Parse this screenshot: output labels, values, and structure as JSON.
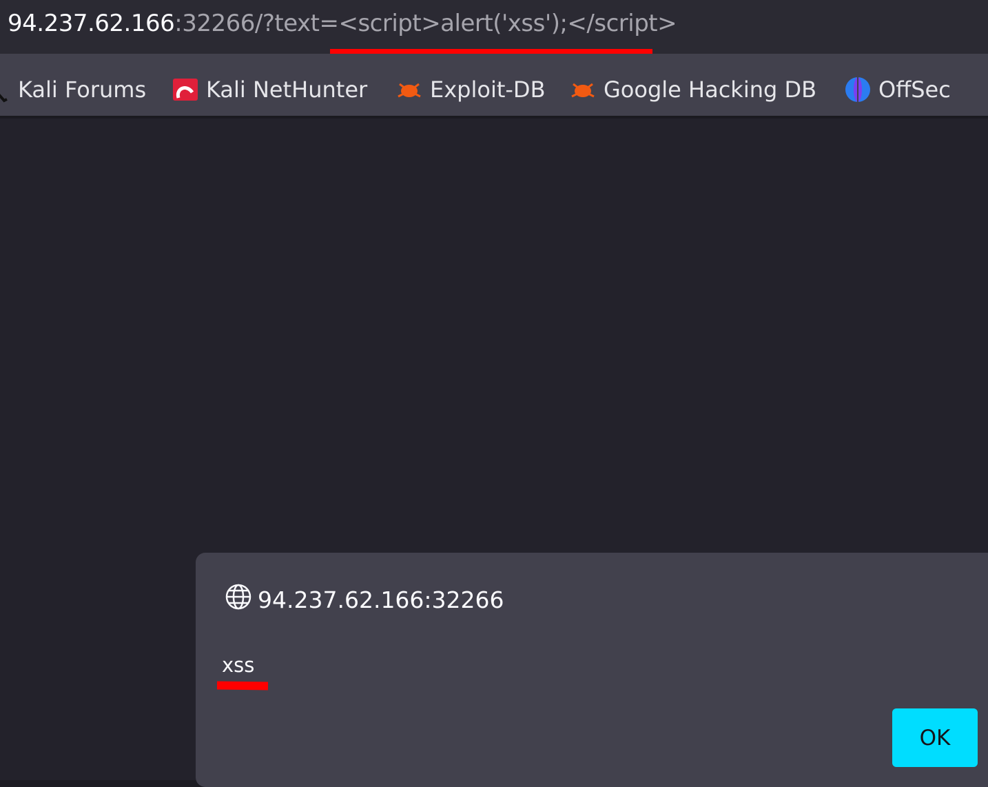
{
  "address_bar": {
    "host": "94.237.62.166",
    "rest": ":32266/?text=<script>alert('xss');</script>"
  },
  "bookmarks": [
    {
      "label": "Kali Forums",
      "icon": "kali-dragon-icon"
    },
    {
      "label": "Kali NetHunter",
      "icon": "nethunter-icon"
    },
    {
      "label": "Exploit-DB",
      "icon": "exploit-db-bug-icon"
    },
    {
      "label": "Google Hacking DB",
      "icon": "ghdb-bug-icon"
    },
    {
      "label": "OffSec",
      "icon": "offsec-icon"
    }
  ],
  "alert_dialog": {
    "origin": "94.237.62.166:32266",
    "message": "xss",
    "ok_label": "OK"
  },
  "colors": {
    "annotation": "#ff0000",
    "ok_button": "#00ddff"
  }
}
